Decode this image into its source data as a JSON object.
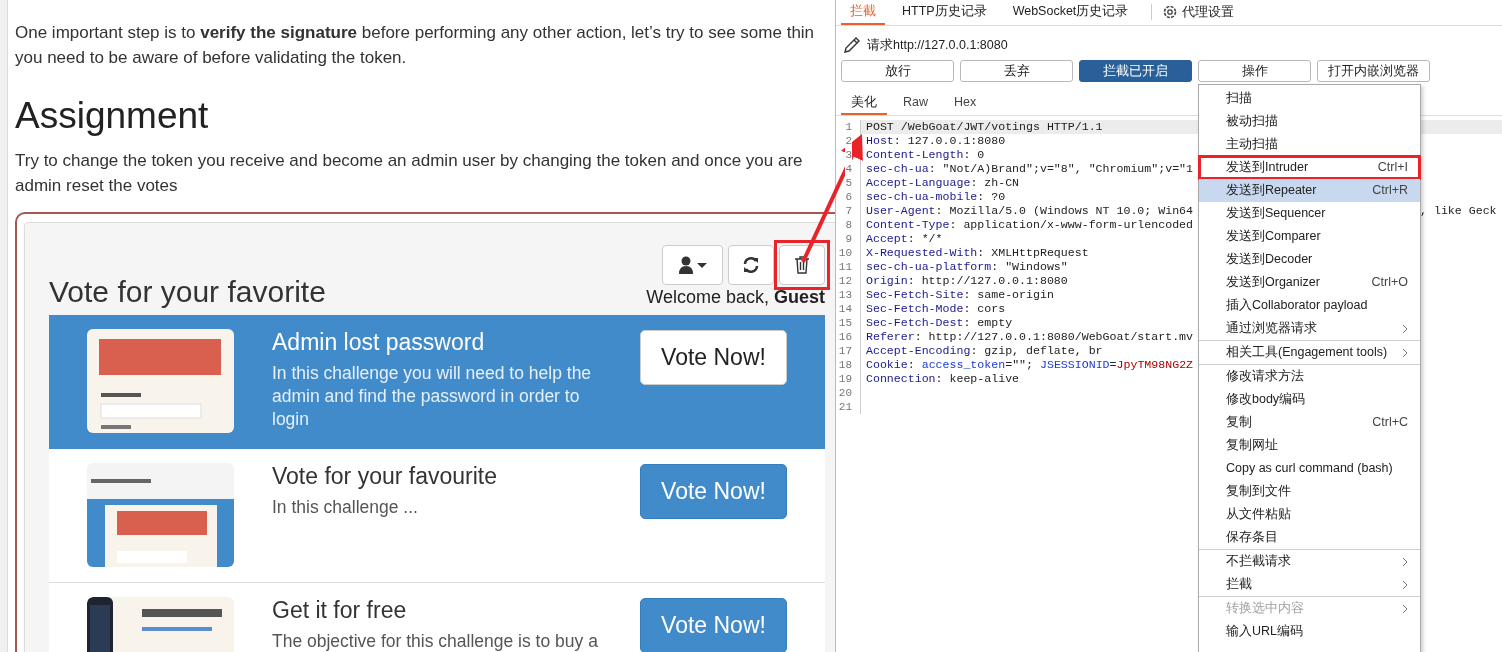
{
  "page": {
    "intro_lines": [
      "One important step is to **verify the signature** before performing any other action, let’s try to see some thin",
      "you need to be aware of before validating the token."
    ],
    "heading": "Assignment",
    "assignment_lines": [
      "Try to change the token you receive and become an admin user by changing the token and once you are",
      "admin reset the votes"
    ],
    "vote": {
      "title": "Vote for your favorite",
      "toolbar": [
        {
          "kind": "user",
          "annotated": false
        },
        {
          "kind": "refresh",
          "annotated": false
        },
        {
          "kind": "delete",
          "annotated": true
        }
      ],
      "welcome": "Welcome back, **Guest**",
      "cards": [
        {
          "title": "Admin lost password",
          "description": "In this challenge you will need to help the admin and find the password in order to login",
          "button": "Vote Now!",
          "selected": true
        },
        {
          "title": "Vote for your favourite",
          "description": "In this challenge ...",
          "button": "Vote Now!",
          "selected": false
        },
        {
          "title": "Get it for free",
          "description": "The objective for this challenge is to buy a",
          "button": "Vote Now!",
          "selected": false
        }
      ]
    }
  },
  "burp": {
    "tabs": [
      {
        "label": "拦截",
        "selected": true
      },
      {
        "label": "HTTP历史记录",
        "selected": false
      },
      {
        "label": "WebSocket历史记录",
        "selected": false
      }
    ],
    "settings": "代理设置",
    "request_label": "请求http://127.0.0.1:8080",
    "buttons": [
      {
        "label": "放行",
        "on": false
      },
      {
        "label": "丢弃",
        "on": false
      },
      {
        "label": "拦截已开启",
        "on": true
      },
      {
        "label": "操作",
        "on": false
      },
      {
        "label": "打开内嵌浏览器",
        "on": false
      }
    ],
    "editor_tabs": [
      {
        "label": "美化",
        "selected": true
      },
      {
        "label": "Raw",
        "selected": false
      },
      {
        "label": "Hex",
        "selected": false
      }
    ],
    "code": [
      {
        "number": "1",
        "selected": true,
        "segments": [
          {
            "kind": "value",
            "text": "POST /WebGoat/JWT/votings HTTP/1.1"
          }
        ]
      },
      {
        "number": "2",
        "selected": false,
        "segments": [
          {
            "kind": "name",
            "text": "Host"
          },
          {
            "kind": "value",
            "text": ": 127.0.0.1:8080"
          }
        ]
      },
      {
        "number": "3",
        "selected": false,
        "segments": [
          {
            "kind": "name",
            "text": "Content-Length"
          },
          {
            "kind": "value",
            "text": ": 0"
          }
        ]
      },
      {
        "number": "4",
        "selected": false,
        "segments": [
          {
            "kind": "name",
            "text": "sec-ch-ua"
          },
          {
            "kind": "value",
            "text": ": \"Not/A)Brand\";v=\"8\", \"Chromium\";v=\"1"
          }
        ]
      },
      {
        "number": "5",
        "selected": false,
        "segments": [
          {
            "kind": "name",
            "text": "Accept-Language"
          },
          {
            "kind": "value",
            "text": ": zh-CN"
          }
        ]
      },
      {
        "number": "6",
        "selected": false,
        "segments": [
          {
            "kind": "name",
            "text": "sec-ch-ua-mobile"
          },
          {
            "kind": "value",
            "text": ": ?0"
          }
        ]
      },
      {
        "number": "7",
        "selected": false,
        "segments": [
          {
            "kind": "name",
            "text": "User-Agent"
          },
          {
            "kind": "value",
            "text": ": Mozilla/5.0 (Windows NT 10.0; Win64"
          }
        ],
        "tail": ", like Geck"
      },
      {
        "number": "8",
        "selected": false,
        "segments": [
          {
            "kind": "name",
            "text": "Content-Type"
          },
          {
            "kind": "value",
            "text": ": application/x-www-form-urlencoded"
          }
        ]
      },
      {
        "number": "9",
        "selected": false,
        "segments": [
          {
            "kind": "name",
            "text": "Accept"
          },
          {
            "kind": "value",
            "text": ": */*"
          }
        ]
      },
      {
        "number": "10",
        "selected": false,
        "segments": [
          {
            "kind": "name",
            "text": "X-Requested-With"
          },
          {
            "kind": "value",
            "text": ": XMLHttpRequest"
          }
        ]
      },
      {
        "number": "11",
        "selected": false,
        "segments": [
          {
            "kind": "name",
            "text": "sec-ch-ua-platform"
          },
          {
            "kind": "value",
            "text": ": \"Windows\""
          }
        ]
      },
      {
        "number": "12",
        "selected": false,
        "segments": [
          {
            "kind": "name",
            "text": "Origin"
          },
          {
            "kind": "value",
            "text": ": http://127.0.0.1:8080"
          }
        ]
      },
      {
        "number": "13",
        "selected": false,
        "segments": [
          {
            "kind": "name",
            "text": "Sec-Fetch-Site"
          },
          {
            "kind": "value",
            "text": ": same-origin"
          }
        ]
      },
      {
        "number": "14",
        "selected": false,
        "segments": [
          {
            "kind": "name",
            "text": "Sec-Fetch-Mode"
          },
          {
            "kind": "value",
            "text": ": cors"
          }
        ]
      },
      {
        "number": "15",
        "selected": false,
        "segments": [
          {
            "kind": "name",
            "text": "Sec-Fetch-Dest"
          },
          {
            "kind": "value",
            "text": ": empty"
          }
        ]
      },
      {
        "number": "16",
        "selected": false,
        "segments": [
          {
            "kind": "name",
            "text": "Referer"
          },
          {
            "kind": "value",
            "text": ": http://127.0.0.1:8080/WebGoat/start.mv"
          }
        ]
      },
      {
        "number": "17",
        "selected": false,
        "segments": [
          {
            "kind": "name",
            "text": "Accept-Encoding"
          },
          {
            "kind": "value",
            "text": ": gzip, deflate, br"
          }
        ]
      },
      {
        "number": "18",
        "selected": false,
        "segments": [
          {
            "kind": "name",
            "text": "Cookie"
          },
          {
            "kind": "value",
            "text": ": "
          },
          {
            "kind": "cookie_name",
            "text": "access_token"
          },
          {
            "kind": "value",
            "text": "=\"\"; "
          },
          {
            "kind": "cookie_name",
            "text": "JSESSIONID"
          },
          {
            "kind": "value",
            "text": "="
          },
          {
            "kind": "cookie_value",
            "text": "JpyTM98NG2Z"
          }
        ]
      },
      {
        "number": "19",
        "selected": false,
        "segments": [
          {
            "kind": "name",
            "text": "Connection"
          },
          {
            "kind": "value",
            "text": ": keep-alive"
          }
        ]
      },
      {
        "number": "20",
        "selected": false
      },
      {
        "number": "21",
        "selected": false
      }
    ],
    "menu": {
      "sections": [
        [
          {
            "label": "扫描",
            "submenu": false,
            "selected": false,
            "disabled": false,
            "annotated": false
          },
          {
            "label": "被动扫描",
            "submenu": false,
            "selected": false,
            "disabled": false,
            "annotated": false
          },
          {
            "label": "主动扫描",
            "submenu": false,
            "selected": false,
            "disabled": false,
            "annotated": false
          },
          {
            "label": "发送到Intruder",
            "shortcut": "Ctrl+I",
            "submenu": false,
            "selected": false,
            "disabled": false,
            "annotated": true
          },
          {
            "label": "发送到Repeater",
            "shortcut": "Ctrl+R",
            "submenu": false,
            "selected": true,
            "disabled": false,
            "annotated": false
          },
          {
            "label": "发送到Sequencer",
            "submenu": false,
            "selected": false,
            "disabled": false,
            "annotated": false
          },
          {
            "label": "发送到Comparer",
            "submenu": false,
            "selected": false,
            "disabled": false,
            "annotated": false
          },
          {
            "label": "发送到Decoder",
            "submenu": false,
            "selected": false,
            "disabled": false,
            "annotated": false
          },
          {
            "label": "发送到Organizer",
            "shortcut": "Ctrl+O",
            "submenu": false,
            "selected": false,
            "disabled": false,
            "annotated": false
          },
          {
            "label": "插入Collaborator payload",
            "submenu": false,
            "selected": false,
            "disabled": false,
            "annotated": false
          },
          {
            "label": "通过浏览器请求",
            "submenu": true,
            "selected": false,
            "disabled": false,
            "annotated": false
          }
        ],
        [
          {
            "label": "相关工具(Engagement tools)",
            "submenu": true,
            "selected": false,
            "disabled": false,
            "annotated": false
          }
        ],
        [
          {
            "label": "修改请求方法",
            "submenu": false,
            "selected": false,
            "disabled": false,
            "annotated": false
          },
          {
            "label": "修改body编码",
            "submenu": false,
            "selected": false,
            "disabled": false,
            "annotated": false
          },
          {
            "label": "复制",
            "shortcut": "Ctrl+C",
            "submenu": false,
            "selected": false,
            "disabled": false,
            "annotated": false
          },
          {
            "label": "复制网址",
            "submenu": false,
            "selected": false,
            "disabled": false,
            "annotated": false
          },
          {
            "label": "Copy as curl command (bash)",
            "submenu": false,
            "selected": false,
            "disabled": false,
            "annotated": false
          },
          {
            "label": "复制到文件",
            "submenu": false,
            "selected": false,
            "disabled": false,
            "annotated": false
          },
          {
            "label": "从文件粘贴",
            "submenu": false,
            "selected": false,
            "disabled": false,
            "annotated": false
          },
          {
            "label": "保存条目",
            "submenu": false,
            "selected": false,
            "disabled": false,
            "annotated": false
          }
        ],
        [
          {
            "label": "不拦截请求",
            "submenu": true,
            "selected": false,
            "disabled": false,
            "annotated": false
          },
          {
            "label": "拦截",
            "submenu": true,
            "selected": false,
            "disabled": false,
            "annotated": false
          }
        ],
        [
          {
            "label": "转换选中内容",
            "submenu": true,
            "selected": false,
            "disabled": true,
            "annotated": false
          },
          {
            "label": "输入URL编码",
            "submenu": false,
            "selected": false,
            "disabled": false,
            "annotated": false
          }
        ]
      ]
    }
  }
}
